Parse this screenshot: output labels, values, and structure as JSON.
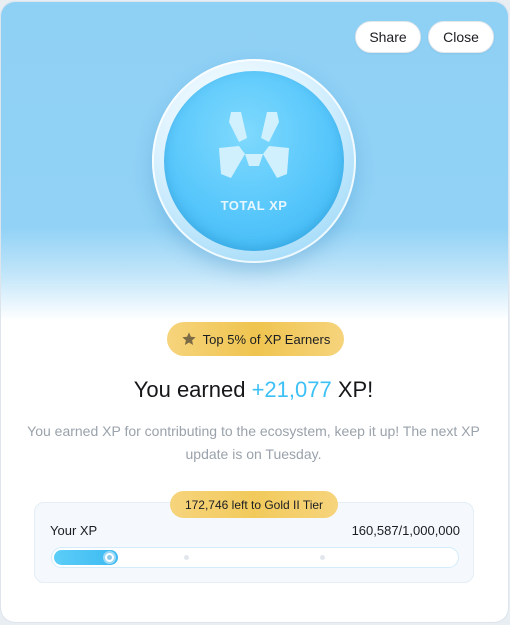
{
  "header": {
    "share_label": "Share",
    "close_label": "Close"
  },
  "coin": {
    "icon": "total-xp-logo",
    "label": "TOTAL XP"
  },
  "badge": {
    "icon": "star-icon",
    "label": "Top 5% of XP Earners"
  },
  "headline": {
    "prefix": "You earned ",
    "value": "+21,077",
    "suffix": " XP!"
  },
  "description": "You earned XP for contributing to the ecosystem, keep it up! The next XP update is on Tuesday.",
  "progress": {
    "tier_note": "172,746 left to Gold II Tier",
    "label": "Your XP",
    "count_text": "160,587/1,000,000",
    "fraction": 0.16
  },
  "colors": {
    "accent": "#3cc0f5",
    "gold": "#efc44f",
    "hero_top": "#8fd0f5"
  }
}
